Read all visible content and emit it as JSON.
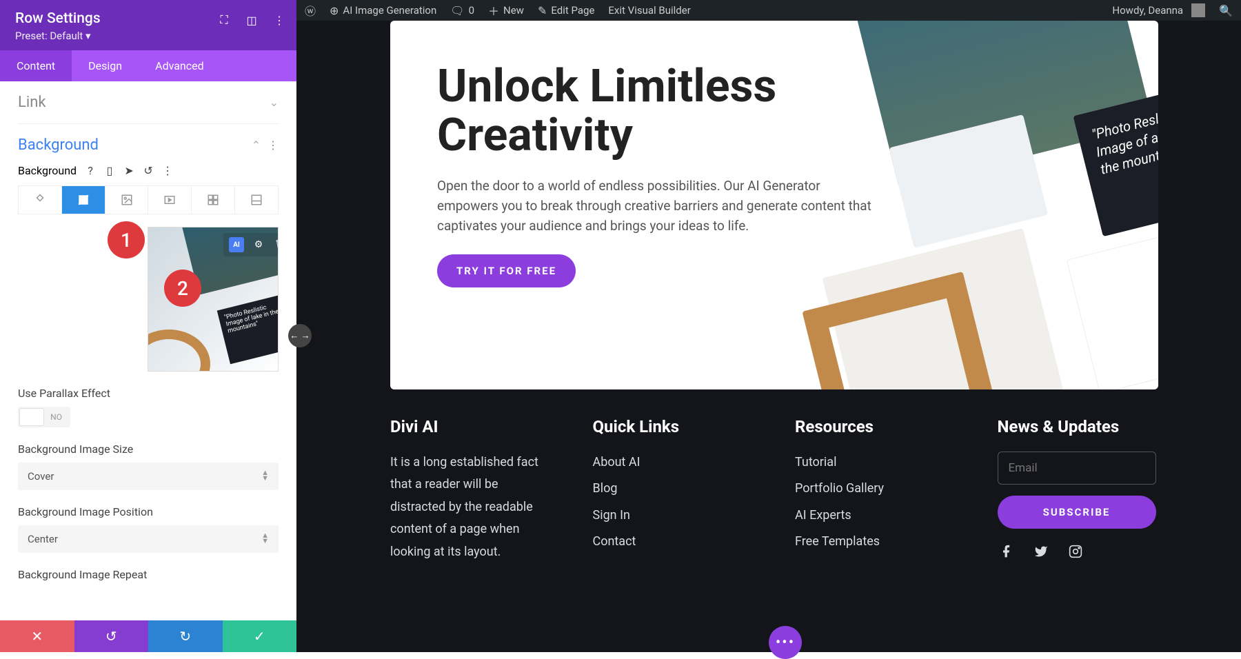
{
  "sidebar": {
    "title": "Row Settings",
    "preset": "Preset: Default ▾",
    "tabs": {
      "content": "Content",
      "design": "Design",
      "advanced": "Advanced"
    },
    "sections": {
      "link": "Link",
      "background": "Background"
    },
    "bg_label": "Background",
    "bg_preview_text": "\"Photo Reslistic Image of lake in the mountains\"",
    "annotations": {
      "one": "1",
      "two": "2"
    },
    "parallax": {
      "label": "Use Parallax Effect",
      "value": "NO"
    },
    "img_size": {
      "label": "Background Image Size",
      "value": "Cover"
    },
    "img_pos": {
      "label": "Background Image Position",
      "value": "Center"
    },
    "img_repeat": {
      "label": "Background Image Repeat"
    }
  },
  "adminbar": {
    "site": "AI Image Generation",
    "comments": "0",
    "new": "New",
    "edit": "Edit Page",
    "exit": "Exit Visual Builder",
    "howdy": "Howdy, Deanna"
  },
  "hero": {
    "heading": "Unlock Limitless Creativity",
    "body": "Open the door to a world of endless possibilities. Our AI Generator empowers you to break through creative barriers and generate content that captivates your audience and brings your ideas to life.",
    "cta": "TRY IT FOR FREE",
    "card_text": "\"Photo Reslistic Image of a lake in the mountains\""
  },
  "footer": {
    "col1": {
      "title": "Divi AI",
      "body": "It is a long established fact that a reader will be distracted by the readable content of a page when looking at its layout."
    },
    "col2": {
      "title": "Quick Links",
      "links": [
        "About AI",
        "Blog",
        "Sign In",
        "Contact"
      ]
    },
    "col3": {
      "title": "Resources",
      "links": [
        "Tutorial",
        "Portfolio Gallery",
        "AI Experts",
        "Free Templates"
      ]
    },
    "col4": {
      "title": "News & Updates",
      "placeholder": "Email",
      "button": "SUBSCRIBE"
    }
  }
}
